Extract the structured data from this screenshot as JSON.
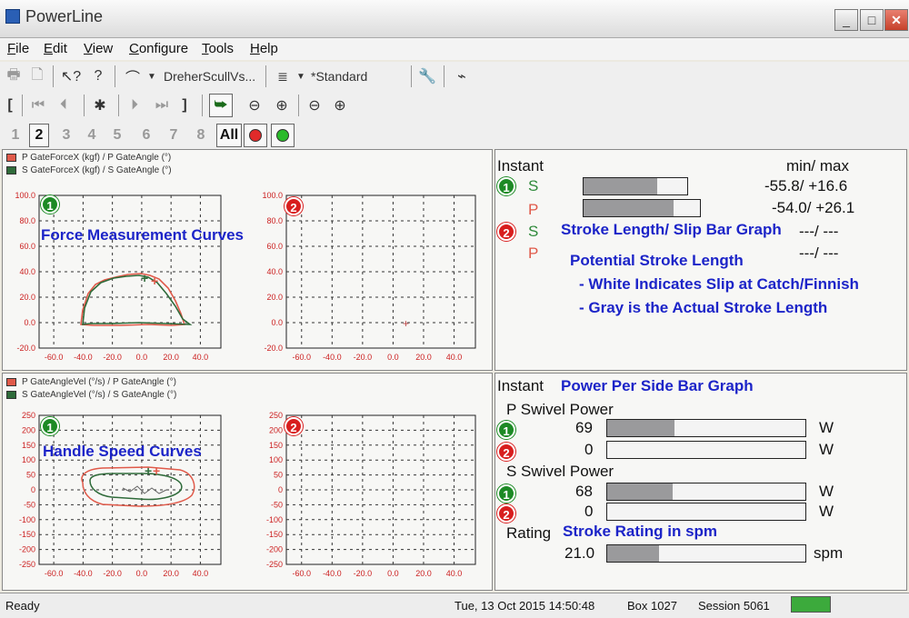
{
  "window": {
    "title": "PowerLine",
    "min": "_",
    "max": "□",
    "close": "✕"
  },
  "menu": [
    "File",
    "Edit",
    "View",
    "Configure",
    "Tools",
    "Help"
  ],
  "toolbar": {
    "boat_label": "DreherScullVs...",
    "layout_label": "*Standard"
  },
  "playbar": {
    "start": "[",
    "end": "]",
    "mark": "✱"
  },
  "seat_buttons": [
    "1",
    "2",
    "3",
    "4",
    "5",
    "6",
    "7",
    "8"
  ],
  "all_label": "All",
  "force_panel": {
    "legend": [
      {
        "label": "P GateForceX (kgf) / P GateAngle (°)",
        "color": "#e05a4a"
      },
      {
        "label": "S GateForceX (kgf) / S GateAngle (°)",
        "color": "#2f6b3a"
      }
    ],
    "y_ticks": [
      "100.0",
      "80.0",
      "60.0",
      "40.0",
      "20.0",
      "0.0",
      "-20.0"
    ],
    "x_ticks": [
      "-60.0",
      "-40.0",
      "-20.0",
      "0.0",
      "20.0",
      "40.0"
    ],
    "annotation": "Force Measurement Curves"
  },
  "speed_panel": {
    "legend": [
      {
        "label": "P GateAngleVel (°/s) / P GateAngle (°)",
        "color": "#e05a4a"
      },
      {
        "label": "S GateAngleVel (°/s) / S GateAngle (°)",
        "color": "#2f6b3a"
      }
    ],
    "y_ticks": [
      "250",
      "200",
      "150",
      "100",
      "50",
      "0",
      "-50",
      "-100",
      "-150",
      "-200",
      "-250"
    ],
    "x_ticks": [
      "-60.0",
      "-40.0",
      "-20.0",
      "0.0",
      "20.0",
      "40.0"
    ],
    "annotation": "Handle Speed Curves"
  },
  "badges": {
    "one": "1",
    "two": "2"
  },
  "instant_top": {
    "title": "Instant",
    "minmax_header": "min/    max",
    "rows": [
      {
        "side": "S",
        "color": "#2f8a3a",
        "minmax": "-55.8/ +16.6",
        "fill": 0.71
      },
      {
        "side": "P",
        "color": "#e05a4a",
        "minmax": "-54.0/ +26.1",
        "fill": 0.77
      },
      {
        "side": "S",
        "color": "#2f8a3a",
        "minmax": "---/    ---",
        "fill": 0
      },
      {
        "side": "P",
        "color": "#e05a4a",
        "minmax": "---/    ---",
        "fill": 0
      }
    ],
    "annotation_title": "Stroke Length/ Slip Bar Graph",
    "annotation_potential": "Potential Stroke Length",
    "annotation_white": "- White Indicates Slip at Catch/Finnish",
    "annotation_gray": "- Gray is the Actual Stroke Length"
  },
  "instant_bottom": {
    "title": "Instant",
    "annotation_power": "Power Per Side Bar Graph",
    "p_label": "P Swivel Power",
    "s_label": "S Swivel Power",
    "p_rows": [
      {
        "value": "69",
        "unit": "W",
        "fill": 0.34
      },
      {
        "value": "0",
        "unit": "W",
        "fill": 0
      }
    ],
    "s_rows": [
      {
        "value": "68",
        "unit": "W",
        "fill": 0.33
      },
      {
        "value": "0",
        "unit": "W",
        "fill": 0
      }
    ],
    "rating_label": "Rating",
    "annotation_rating": "Stroke Rating in spm",
    "rating_value": "21.0",
    "rating_unit": "spm",
    "rating_fill": 0.26
  },
  "status": {
    "ready": "Ready",
    "datetime": "Tue, 13 Oct 2015 14:50:48",
    "box": "Box 1027",
    "session": "Session 5061",
    "indicator_color": "#3caa3c"
  }
}
